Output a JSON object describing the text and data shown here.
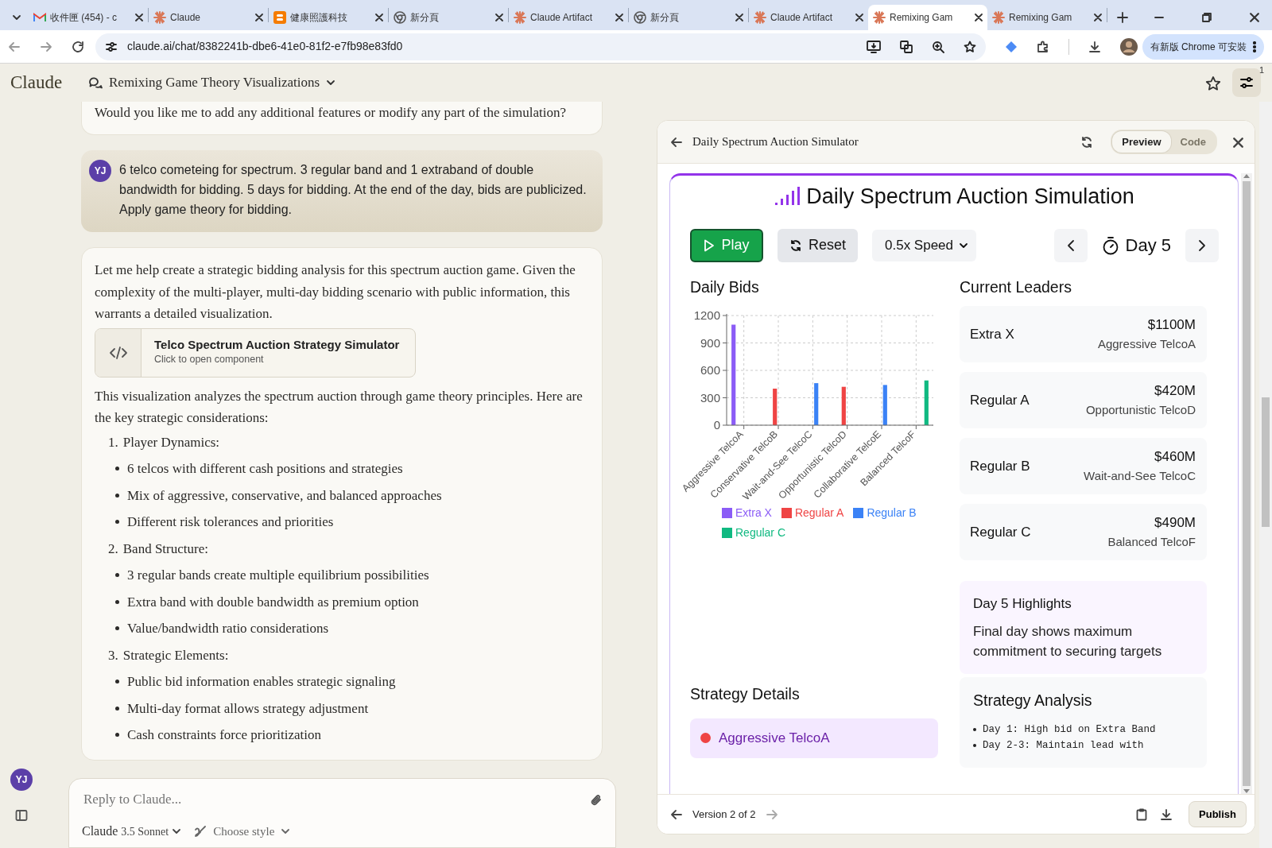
{
  "browser": {
    "tabs": [
      {
        "kind": "gmail",
        "title": "收件匣 (454) - c",
        "selected": false
      },
      {
        "kind": "claude",
        "title": "Claude",
        "selected": false
      },
      {
        "kind": "blogger",
        "title": "健康照護科技",
        "selected": false
      },
      {
        "kind": "chrome",
        "title": "新分頁",
        "selected": false
      },
      {
        "kind": "claude",
        "title": "Claude Artifact",
        "selected": false
      },
      {
        "kind": "chrome",
        "title": "新分頁",
        "selected": false
      },
      {
        "kind": "claude",
        "title": "Claude Artifact",
        "selected": false
      },
      {
        "kind": "claude",
        "title": "Remixing Gam",
        "selected": true
      },
      {
        "kind": "claude",
        "title": "Remixing Gam",
        "selected": false
      }
    ],
    "address": "claude.ai/chat/8382241b-dbe6-41e0-81f2-e7fb98e83fd0",
    "update_button": "有新版 Chrome 可安裝"
  },
  "app": {
    "logo": "Claude",
    "chat_title": "Remixing Game Theory Visualizations",
    "tools_badge": "1",
    "user_initials": "YJ"
  },
  "messages": [
    {
      "kind": "assistant_tail",
      "text": "Would you like me to add any additional features or modify any part of the simulation?"
    },
    {
      "kind": "user",
      "avatar": "YJ",
      "text": "6 telco cometeing for spectrum. 3 regular band and 1 extraband of double bandwidth for bidding. 5 days for bidding. At the end of the day, bids are publicized. Apply game theory for bidding."
    },
    {
      "kind": "assistant",
      "blocks": [
        {
          "kind": "paragraph",
          "text": "Let me help create a strategic bidding analysis for this spectrum auction game. Given the complexity of the multi-player, multi-day bidding scenario with public information, this warrants a detailed visualization."
        },
        {
          "kind": "artifact",
          "title": "Telco Spectrum Auction Strategy Simulator",
          "subtitle": "Click to open component"
        },
        {
          "kind": "paragraph",
          "text": "This visualization analyzes the spectrum auction through game theory principles. Here are the key strategic considerations:"
        },
        {
          "kind": "numbered",
          "number": "1.",
          "text": "Player Dynamics:"
        },
        {
          "kind": "bullet",
          "text": "6 telcos with different cash positions and strategies"
        },
        {
          "kind": "bullet",
          "text": "Mix of aggressive, conservative, and balanced approaches"
        },
        {
          "kind": "bullet",
          "text": "Different risk tolerances and priorities"
        },
        {
          "kind": "numbered",
          "number": "2.",
          "text": "Band Structure:"
        },
        {
          "kind": "bullet",
          "text": "3 regular bands create multiple equilibrium possibilities"
        },
        {
          "kind": "bullet",
          "text": "Extra band with double bandwidth as premium option"
        },
        {
          "kind": "bullet",
          "text": "Value/bandwidth ratio considerations"
        },
        {
          "kind": "numbered",
          "number": "3.",
          "text": "Strategic Elements:"
        },
        {
          "kind": "bullet",
          "text": "Public bid information enables strategic signaling"
        },
        {
          "kind": "bullet",
          "text": "Multi-day format allows strategy adjustment"
        },
        {
          "kind": "bullet",
          "text": "Cash constraints force prioritization"
        }
      ]
    }
  ],
  "composer": {
    "placeholder": "Reply to Claude...",
    "model_name": "Claude",
    "model_version": "3.5 Sonnet",
    "style": "Choose style"
  },
  "artifact": {
    "title": "Daily Spectrum Auction Simulator",
    "view_tabs": [
      {
        "label": "Preview",
        "selected": true
      },
      {
        "label": "Code",
        "selected": false
      }
    ],
    "heading": "Daily Spectrum Auction Simulation",
    "play": "Play",
    "reset": "Reset",
    "speed": "0.5x Speed",
    "day": "Day 5",
    "bids": {
      "title": "Daily Bids",
      "chart_data": {
        "type": "bar",
        "categories": [
          "Aggressive TelcoA",
          "Conservative TelcoB",
          "Wait-and-See TelcoC",
          "Opportunistic TelcoD",
          "Collaborative TelcoE",
          "Balanced TelcoF"
        ],
        "grid": true,
        "legend": true,
        "ylim": [
          0,
          1200
        ],
        "yticks": [
          0,
          300,
          600,
          900,
          1200
        ],
        "series": [
          {
            "name": "Extra X",
            "color": "#8b5cf6",
            "values": [
              1100,
              null,
              null,
              null,
              null,
              null
            ]
          },
          {
            "name": "Regular A",
            "color": "#ef4444",
            "values": [
              null,
              400,
              null,
              420,
              null,
              null
            ]
          },
          {
            "name": "Regular B",
            "color": "#3b82f6",
            "values": [
              null,
              null,
              460,
              null,
              440,
              null
            ]
          },
          {
            "name": "Regular C",
            "color": "#10b981",
            "values": [
              null,
              null,
              null,
              null,
              null,
              490
            ]
          }
        ]
      }
    },
    "leaders": {
      "title": "Current Leaders",
      "items": [
        {
          "band": "Extra X",
          "amount": "$1100M",
          "telco": "Aggressive TelcoA"
        },
        {
          "band": "Regular A",
          "amount": "$420M",
          "telco": "Opportunistic TelcoD"
        },
        {
          "band": "Regular B",
          "amount": "$460M",
          "telco": "Wait-and-See TelcoC"
        },
        {
          "band": "Regular C",
          "amount": "$490M",
          "telco": "Balanced TelcoF"
        }
      ]
    },
    "highlights": {
      "title": "Day 5 Highlights",
      "text": "Final day shows maximum commitment to securing targets"
    },
    "strategy_details": {
      "title": "Strategy Details",
      "telco": "Aggressive TelcoA"
    },
    "strategy_analysis": {
      "title": "Strategy Analysis",
      "points": [
        "Day 1: High bid on Extra Band",
        "Day 2-3: Maintain lead with"
      ]
    },
    "footer": {
      "version": "Version 2 of 2",
      "publish": "Publish"
    }
  }
}
